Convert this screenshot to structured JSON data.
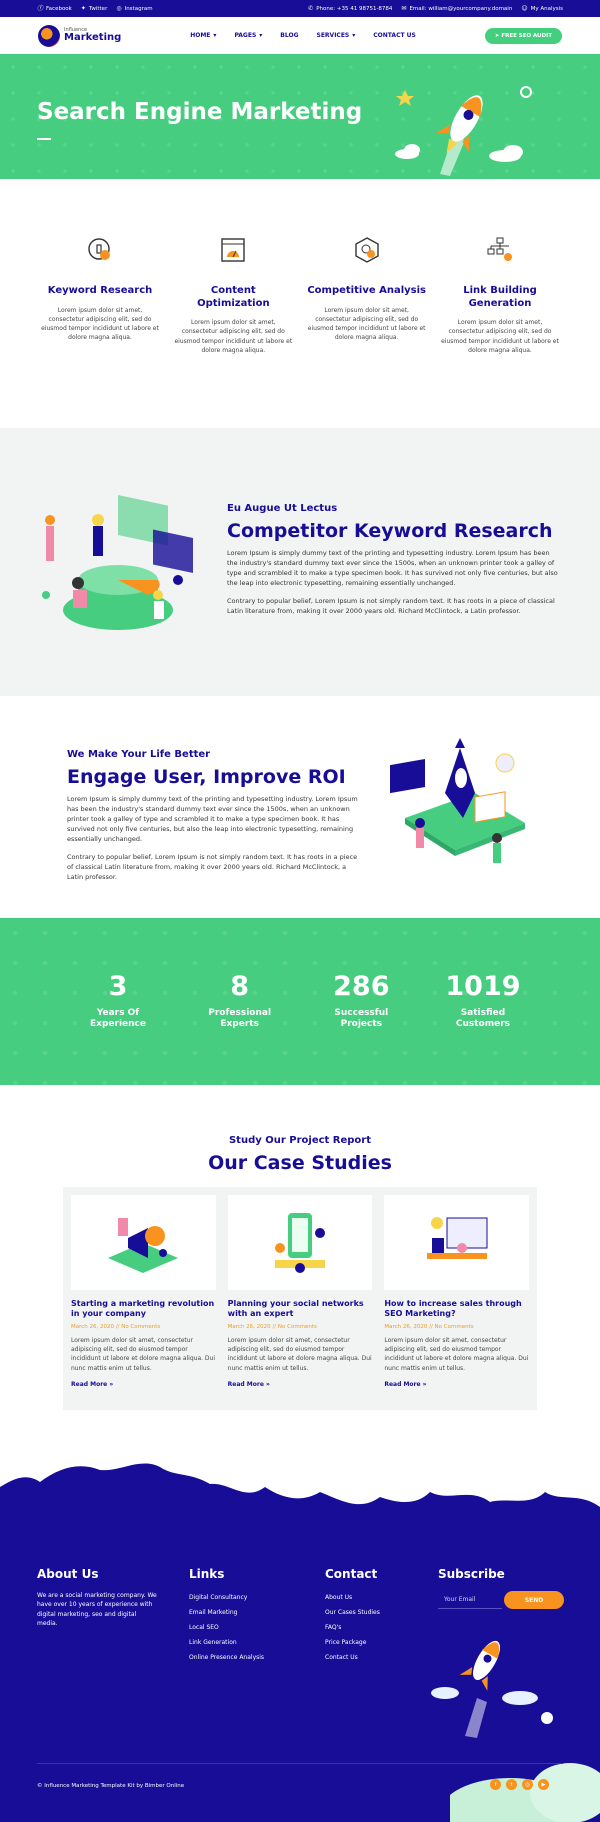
{
  "topbar": {
    "facebook": "Facebook",
    "twitter": "Twitter",
    "instagram": "Instagram",
    "phone": "Phone: +35 41 98751-8784",
    "email": "Email: william@yourcompany.domain",
    "account": "My Analysis"
  },
  "nav": {
    "logo_small": "Influence",
    "logo_big": "Marketing",
    "items": [
      {
        "label": "HOME",
        "caret": "▾"
      },
      {
        "label": "PAGES",
        "caret": "▾"
      },
      {
        "label": "BLOG",
        "caret": ""
      },
      {
        "label": "SERVICES",
        "caret": "▾"
      },
      {
        "label": "CONTACT US",
        "caret": ""
      }
    ],
    "cta": "FREE SEO AUDIT"
  },
  "hero": {
    "title": "Search Engine Marketing"
  },
  "services": [
    {
      "title": "Keyword Research",
      "text": "Lorem ipsum dolor sit amet, consectetur adipiscing elit, sed do eiusmod tempor incididunt ut labore et dolore magna aliqua.",
      "icon": "keyword-research-icon"
    },
    {
      "title": "Content Optimization",
      "text": "Lorem ipsum dolor sit amet, consectetur adipiscing elit, sed do eiusmod tempor incididunt ut labore et dolore magna aliqua.",
      "icon": "content-optimization-icon"
    },
    {
      "title": "Competitive Analysis",
      "text": "Lorem ipsum dolor sit amet, consectetur adipiscing elit, sed do eiusmod tempor incididunt ut labore et dolore magna aliqua.",
      "icon": "competitive-analysis-icon"
    },
    {
      "title": "Link Building Generation",
      "text": "Lorem ipsum dolor sit amet, consectetur adipiscing elit, sed do eiusmod tempor incididunt ut labore et dolore magna aliqua.",
      "icon": "link-building-icon"
    }
  ],
  "competitor": {
    "eyebrow": "Eu Augue Ut Lectus",
    "title": "Competitor Keyword Research",
    "p1": "Lorem Ipsum is simply dummy text of the printing and typesetting industry. Lorem Ipsum has been the industry's standard dummy text ever since the 1500s, when an unknown printer took a galley of type and scrambled it to make a type specimen book. It has survived not only five centuries, but also the leap into electronic typesetting, remaining essentially unchanged.",
    "p2": "Contrary to popular belief, Lorem Ipsum is not simply random text. It has roots in a piece of classical Latin literature from, making it over 2000 years old. Richard McClintock, a Latin professor."
  },
  "engage": {
    "eyebrow": "We Make Your Life Better",
    "title": "Engage User, Improve ROI",
    "p1": "Lorem Ipsum is simply dummy text of the printing and typesetting industry. Lorem Ipsum has been the industry's standard dummy text ever since the 1500s, when an unknown printer took a galley of type and scrambled it to make a type specimen book. It has survived not only five centuries, but also the leap into electronic typesetting, remaining essentially unchanged.",
    "p2": "Contrary to popular belief, Lorem Ipsum is not simply random text. It has roots in a piece of classical Latin literature from, making it over 2000 years old. Richard McClintock, a Latin professor."
  },
  "stats": [
    {
      "number": "3",
      "label": "Years Of Experience"
    },
    {
      "number": "8",
      "label": "Professional Experts"
    },
    {
      "number": "286",
      "label": "Successful Projects"
    },
    {
      "number": "1019",
      "label": "Satisfied Customers"
    }
  ],
  "cases": {
    "eyebrow": "Study Our Project Report",
    "title": "Our Case Studies",
    "items": [
      {
        "title": "Starting a marketing revolution in your company",
        "meta": "March 26, 2020 // No Comments",
        "text": "Lorem ipsum dolor sit amet, consectetur adipiscing elit, sed do eiusmod tempor incididunt ut labore et dolore magna aliqua. Dui nunc mattis enim ut tellus.",
        "link": "Read More »"
      },
      {
        "title": "Planning your social networks with an expert",
        "meta": "March 26, 2020 // No Comments",
        "text": "Lorem ipsum dolor sit amet, consectetur adipiscing elit, sed do eiusmod tempor incididunt ut labore et dolore magna aliqua. Dui nunc mattis enim ut tellus.",
        "link": "Read More »"
      },
      {
        "title": "How to increase sales through SEO Marketing?",
        "meta": "March 26, 2020 // No Comments",
        "text": "Lorem ipsum dolor sit amet, consectetur adipiscing elit, sed do eiusmod tempor incididunt ut labore et dolore magna aliqua. Dui nunc mattis enim ut tellus.",
        "link": "Read More »"
      }
    ]
  },
  "footer": {
    "about_title": "About Us",
    "about_text": "We are a social marketing company. We have over 10 years of experience with digital marketing, seo and digital media.",
    "links_title": "Links",
    "links": [
      "Digital Consultancy",
      "Email Marketing",
      "Local SEO",
      "Link Generation",
      "Online Presence Analysis"
    ],
    "contact_title": "Contact",
    "contact": [
      "About Us",
      "Our Cases Studies",
      "FAQ's",
      "Price Package",
      "Contact Us"
    ],
    "subscribe_title": "Subscribe",
    "email_placeholder": "Your Email",
    "send": "SEND",
    "copyright": "© Influence Marketing Template Kit by Bimber Online"
  },
  "colors": {
    "primary": "#170d96",
    "green": "#46cd80",
    "orange": "#f7931e"
  }
}
